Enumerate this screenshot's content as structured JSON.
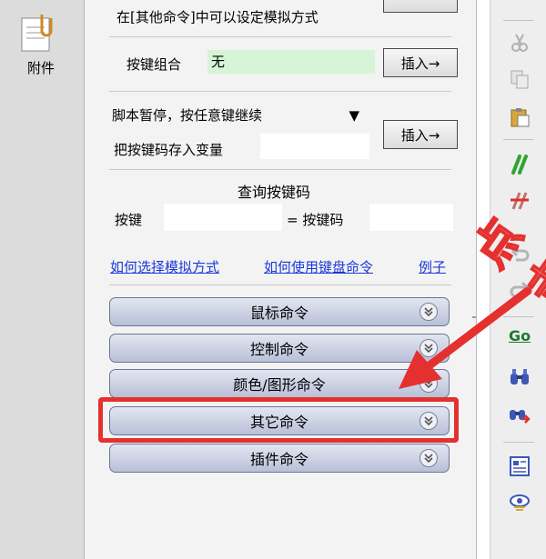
{
  "left": {
    "attach_label": "附件"
  },
  "main": {
    "top_note": "在[其他命令]中可以设定模拟方式",
    "keycombo": {
      "label": "按键组合",
      "value": "无",
      "button": "插入→"
    },
    "pause": {
      "select_value": "脚本暂停，按任意键继续",
      "store_label": "把按键码存入变量",
      "button": "插入→"
    },
    "query": {
      "title": "查询按键码",
      "key_label": "按键",
      "eq_label": "= 按键码"
    },
    "links": [
      "如何选择模拟方式",
      "如何使用键盘命令",
      "例子"
    ],
    "commands": [
      "鼠标命令",
      "控制命令",
      "颜色/图形命令",
      "其它命令",
      "插件命令"
    ]
  },
  "annotation": {
    "text": "点击",
    "color": "#e53030"
  },
  "toolbar": {
    "go_label": "Go",
    "icons": [
      "cut-icon",
      "copy-icon",
      "paste-icon",
      "comment-icon",
      "uncomment-icon",
      "undo-icon",
      "redo-icon",
      "goto-icon",
      "find-icon",
      "find-next-icon",
      "properties-icon",
      "view-icon"
    ]
  },
  "colors": {
    "highlight_green": "#d6f5d6",
    "command_bar": "#c3c9de",
    "link": "#1a39d8",
    "red": "#e53030"
  }
}
